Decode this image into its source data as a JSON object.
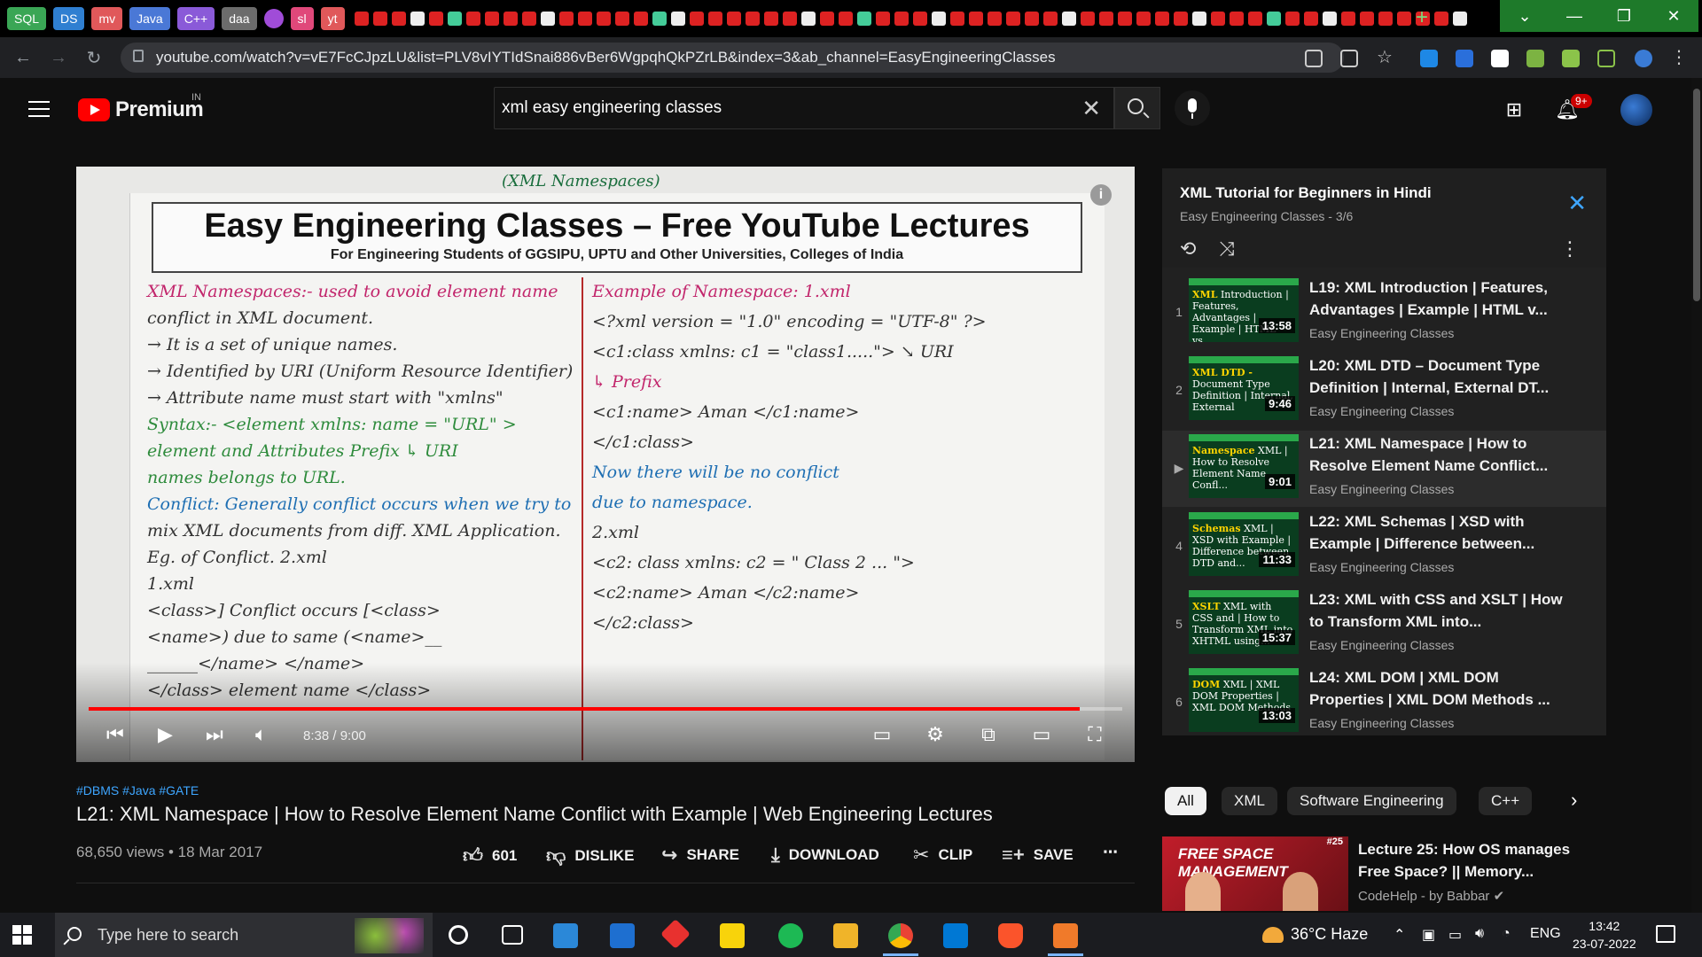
{
  "browser": {
    "bookmarks": [
      {
        "label": "SQL",
        "color": "#3aa655"
      },
      {
        "label": "DS",
        "color": "#2f7fd1"
      },
      {
        "label": "mv",
        "color": "#e0585a"
      },
      {
        "label": "Java",
        "color": "#4a78d6"
      },
      {
        "label": "C++",
        "color": "#8a5ad8"
      },
      {
        "label": "daa",
        "color": "#6c6c6c"
      },
      {
        "label": "",
        "color": "#a04cd8"
      },
      {
        "label": "sl",
        "color": "#e0487a"
      },
      {
        "label": "yt",
        "color": "#e0585a"
      }
    ],
    "url": "youtube.com/watch?v=vE7FcCJpzLU&list=PLV8vIYTIdSnai886vBer6WgpqhQkPZrLB&index=3&ab_channel=EasyEngineeringClasses"
  },
  "header": {
    "logo_text": "Premium",
    "country": "IN",
    "search_value": "xml easy engineering classes",
    "notifications_badge": "9+"
  },
  "player": {
    "board": {
      "topic": "(XML Namespaces)",
      "title": "Easy Engineering Classes – Free YouTube Lectures",
      "subtitle": "For Engineering Students of GGSIPU, UPTU and Other Universities, Colleges of India"
    },
    "notes_left": [
      {
        "text": "XML Namespaces:- used to avoid element name",
        "color": "pink"
      },
      {
        "text": "conflict in XML document.",
        "color": ""
      },
      {
        "text": "→ It is a set of unique names.",
        "color": ""
      },
      {
        "text": "→ Identified by URI (Uniform Resource Identifier)",
        "color": ""
      },
      {
        "text": "→ Attribute name must start with \"xmlns\"",
        "color": ""
      },
      {
        "text": "Syntax:- <element xmlns: name = \"URL\" >",
        "color": "green"
      },
      {
        "text": "element and Attributes Prefix        ↳ URI",
        "color": "green"
      },
      {
        "text": "names belongs to URL.",
        "color": "green"
      },
      {
        "text": "Conflict: Generally conflict occurs when we try to",
        "color": "blue"
      },
      {
        "text": "mix XML documents from diff. XML Application.",
        "color": ""
      },
      {
        "text": "Eg. of Conflict.                2.xml",
        "color": ""
      },
      {
        "text": "1.xml",
        "color": ""
      },
      {
        "text": "<class>] Conflict occurs  [<class>",
        "color": ""
      },
      {
        "text": "  <name>) due to same    (<name>__",
        "color": ""
      },
      {
        "text": "  ______</name>            </name>",
        "color": ""
      },
      {
        "text": "</class>   element name    </class>",
        "color": ""
      }
    ],
    "notes_right": [
      {
        "text": "Example of Namespace:  1.xml",
        "color": "pink"
      },
      {
        "text": "<?xml version = \"1.0\" encoding = \"UTF-8\" ?>",
        "color": ""
      },
      {
        "text": "<c1:class  xmlns: c1 = \"class1.....\">  ↘ URI",
        "color": ""
      },
      {
        "text": "        ↳ Prefix",
        "color": "pink"
      },
      {
        "text": "   <c1:name> Aman </c1:name>",
        "color": ""
      },
      {
        "text": "</c1:class>",
        "color": ""
      },
      {
        "text": "Now there will be no conflict",
        "color": "blue"
      },
      {
        "text": "due to namespace.",
        "color": "blue"
      },
      {
        "text": "2.xml",
        "color": ""
      },
      {
        "text": "<c2: class  xmlns: c2 = \" Class 2 ... \">",
        "color": ""
      },
      {
        "text": "   <c2:name> Aman </c2:name>",
        "color": ""
      },
      {
        "text": "</c2:class>",
        "color": ""
      }
    ],
    "progress_fraction": 0.959,
    "time": "8:38 / 9:00"
  },
  "video": {
    "hashtags": "#DBMS #Java #GATE",
    "title": "L21: XML Namespace | How to Resolve Element Name Conflict with Example | Web Engineering Lectures",
    "meta": "68,650 views • 18 Mar 2017",
    "likes": "601",
    "dislike_label": "DISLIKE",
    "share_label": "SHARE",
    "download_label": "DOWNLOAD",
    "clip_label": "CLIP",
    "save_label": "SAVE"
  },
  "playlist": {
    "title": "XML Tutorial for Beginners in Hindi",
    "subtitle": "Easy Engineering Classes - 3/6",
    "items": [
      {
        "index": "1",
        "thumb_hl": "XML",
        "thumb_text": "Introduction | Features, Advantages | Example | HTML vs...",
        "duration": "13:58",
        "title": "L19: XML Introduction | Features, Advantages | Example | HTML v...",
        "channel": "Easy Engineering Classes"
      },
      {
        "index": "2",
        "thumb_hl": "XML DTD -",
        "thumb_text": "Document Type Definition | Internal, External",
        "duration": "9:46",
        "title": "L20: XML DTD – Document Type Definition | Internal, External DT...",
        "channel": "Easy Engineering Classes"
      },
      {
        "index": "▶",
        "thumb_hl": "Namespace",
        "thumb_text": "XML | How to Resolve Element Name Confl...",
        "duration": "9:01",
        "title": "L21: XML Namespace | How to Resolve Element Name Conflict...",
        "channel": "Easy Engineering Classes"
      },
      {
        "index": "4",
        "thumb_hl": "Schemas",
        "thumb_text": "XML | XSD with Example | Difference between DTD and...",
        "duration": "11:33",
        "title": "L22: XML Schemas | XSD with Example | Difference between...",
        "channel": "Easy Engineering Classes"
      },
      {
        "index": "5",
        "thumb_hl": "XSLT",
        "thumb_text": "XML with CSS and | How to Transform XML into XHTML using...",
        "duration": "15:37",
        "title": "L23: XML with CSS and XSLT | How to Transform XML into...",
        "channel": "Easy Engineering Classes"
      },
      {
        "index": "6",
        "thumb_hl": "DOM",
        "thumb_text": "XML | XML DOM Properties | XML DOM Methods",
        "duration": "13:03",
        "title": "L24: XML DOM | XML DOM Properties | XML DOM Methods ...",
        "channel": "Easy Engineering Classes"
      }
    ]
  },
  "chips": [
    "All",
    "XML",
    "Software Engineering",
    "C++"
  ],
  "recommendation": {
    "thumb_text": "FREE SPACE MANAGEMENT",
    "thumb_num": "#25",
    "title": "Lecture 25: How OS manages Free Space? || Memory...",
    "channel": "CodeHelp - by Babbar"
  },
  "taskbar": {
    "search_placeholder": "Type here to search",
    "weather": "36°C  Haze",
    "language": "ENG",
    "time": "13:42",
    "date": "23-07-2022"
  }
}
